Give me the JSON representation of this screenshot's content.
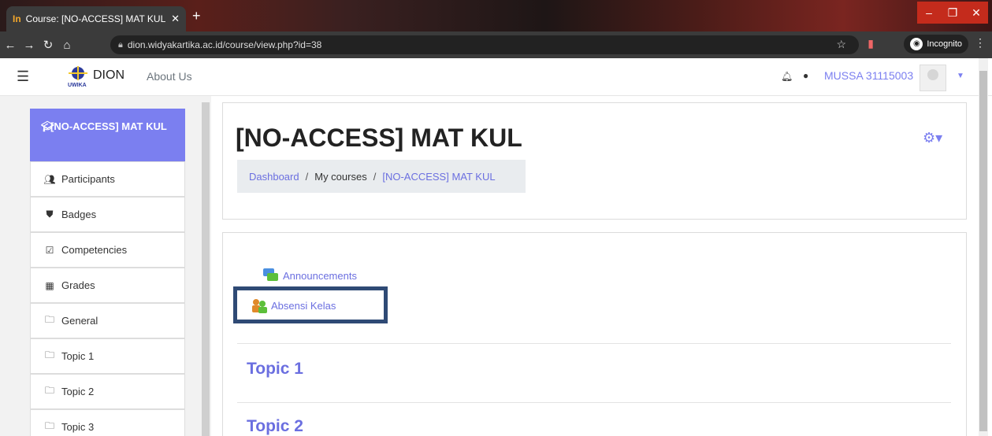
{
  "browser": {
    "tab_title": "Course: [NO-ACCESS] MAT KUL",
    "tab_favicon": "In",
    "new_tab": "+",
    "url": "dion.widyakartika.ac.id/course/view.php?id=38",
    "incognito_label": "Incognito"
  },
  "navbar": {
    "brand": "DION",
    "logo_text": "UWIKA",
    "about": "About Us",
    "user": "MUSSA 31115003"
  },
  "sidebar": {
    "active_label": "[NO-ACCESS] MAT KUL",
    "items": [
      {
        "label": "Participants",
        "icon": "users-icon"
      },
      {
        "label": "Badges",
        "icon": "shield-icon"
      },
      {
        "label": "Competencies",
        "icon": "checkbox-icon"
      },
      {
        "label": "Grades",
        "icon": "table-icon"
      },
      {
        "label": "General",
        "icon": "folder-icon"
      },
      {
        "label": "Topic 1",
        "icon": "folder-icon"
      },
      {
        "label": "Topic 2",
        "icon": "folder-icon"
      },
      {
        "label": "Topic 3",
        "icon": "folder-icon"
      }
    ]
  },
  "course": {
    "title": "[NO-ACCESS] MAT KUL",
    "breadcrumb": [
      "Dashboard",
      "My courses",
      "[NO-ACCESS] MAT KUL"
    ],
    "activities": [
      "Announcements",
      "Absensi Kelas"
    ],
    "topics": [
      "Topic 1",
      "Topic 2"
    ]
  },
  "colors": {
    "accent": "#7b7ff0",
    "highlight_border": "#2f4a75"
  }
}
